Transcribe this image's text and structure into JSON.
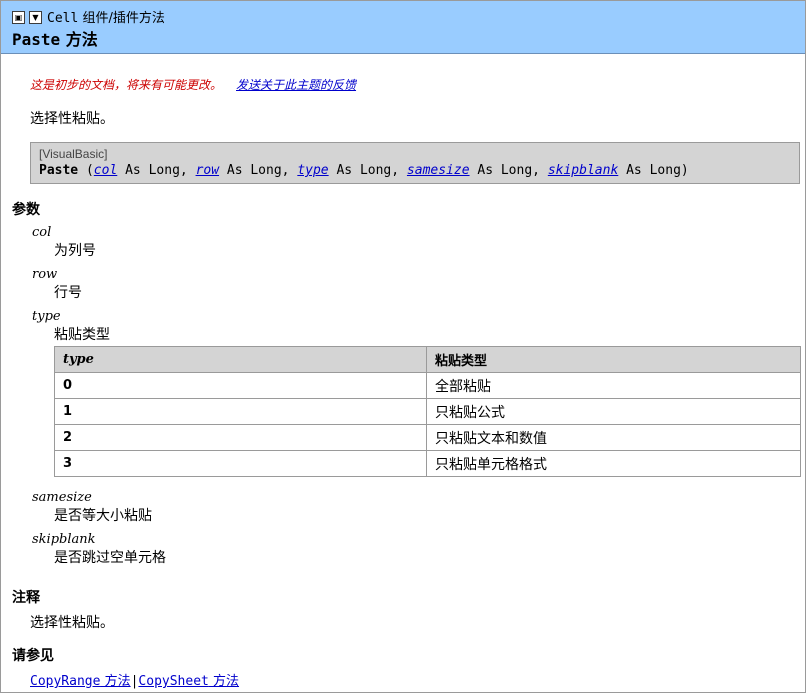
{
  "header": {
    "breadcrumb_code": "Cell",
    "breadcrumb_text": " 组件/插件方法",
    "title_code": "Paste",
    "title_text": " 方法",
    "btn_collapse": "▣",
    "btn_filter": "▼"
  },
  "note": {
    "text": "这是初步的文档，将来有可能更改。",
    "feedback_link": "发送关于此主题的反馈"
  },
  "intro": "选择性粘贴。",
  "syntax": {
    "language": "[VisualBasic]",
    "method": "Paste",
    "open": " (",
    "params": [
      "col",
      "row",
      "type",
      "samesize",
      "skipblank"
    ],
    "as_long": " As Long, ",
    "as_long_last": " As Long)"
  },
  "params_heading": "参数",
  "params": [
    {
      "name": "col",
      "desc": "为列号"
    },
    {
      "name": "row",
      "desc": "行号"
    },
    {
      "name": "type",
      "desc": "粘贴类型"
    },
    {
      "name": "samesize",
      "desc": "是否等大小粘贴"
    },
    {
      "name": "skipblank",
      "desc": "是否跳过空单元格"
    }
  ],
  "type_table": {
    "headers": [
      "type",
      "粘贴类型"
    ],
    "rows": [
      [
        "0",
        "全部粘贴"
      ],
      [
        "1",
        "只粘贴公式"
      ],
      [
        "2",
        "只粘贴文本和数值"
      ],
      [
        "3",
        "只粘贴单元格格式"
      ]
    ]
  },
  "remarks_heading": "注释",
  "remarks": "选择性粘贴。",
  "see_also_heading": "请参见",
  "see_also": {
    "link1_code": "CopyRange",
    "link1_text": " 方法",
    "separator": "|",
    "link2_code": "CopySheet",
    "link2_text": " 方法"
  }
}
